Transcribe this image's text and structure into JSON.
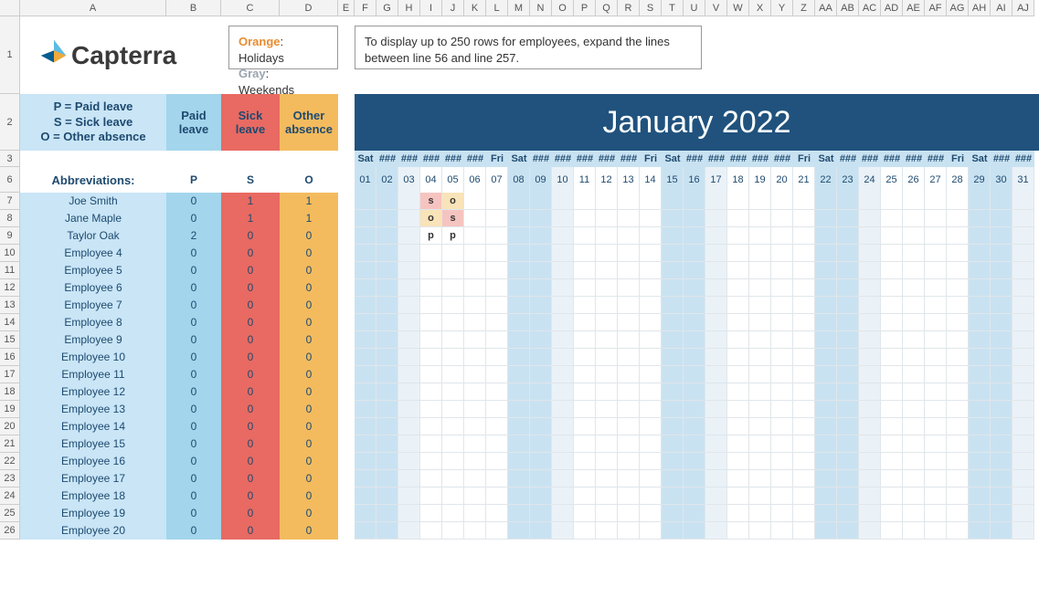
{
  "logo_text": "Capterra",
  "legend": {
    "orange_label": "Orange",
    "orange_text": ": Holidays",
    "gray_label": "Gray",
    "gray_text": ": Weekends"
  },
  "tip_text": "To display up to 250 rows for employees, expand the lines between line 56 and line 257.",
  "key": {
    "p": "P = Paid leave",
    "s": "S = Sick leave",
    "o": "O = Other absence"
  },
  "headers": {
    "paid1": "Paid",
    "paid2": "leave",
    "sick1": "Sick",
    "sick2": "leave",
    "other1": "Other",
    "other2": "absence"
  },
  "month_title": "January 2022",
  "abbrev_label": "Abbreviations:",
  "abbrev": {
    "p": "P",
    "s": "S",
    "o": "O"
  },
  "col_letters": [
    "A",
    "B",
    "C",
    "D",
    "E",
    "F",
    "G",
    "H",
    "I",
    "J",
    "K",
    "L",
    "M",
    "N",
    "O",
    "P",
    "Q",
    "R",
    "S",
    "T",
    "U",
    "V",
    "W",
    "X",
    "Y",
    "Z",
    "AA",
    "AB",
    "AC",
    "AD",
    "AE",
    "AF",
    "AG",
    "AH",
    "AI",
    "AJ"
  ],
  "row_numbers_top": [
    "1",
    "2",
    "3",
    "6"
  ],
  "visible_row_ids": [
    7,
    8,
    9,
    10,
    11,
    12,
    13,
    14,
    15,
    16,
    17,
    18,
    19,
    20,
    21,
    22,
    23,
    24,
    25,
    26
  ],
  "days": [
    {
      "n": "01",
      "wd": "Sat",
      "sat": true
    },
    {
      "n": "02",
      "wd": "###",
      "sun": true
    },
    {
      "n": "03",
      "wd": "###",
      "mon": true
    },
    {
      "n": "04",
      "wd": "###"
    },
    {
      "n": "05",
      "wd": "###"
    },
    {
      "n": "06",
      "wd": "###"
    },
    {
      "n": "07",
      "wd": "Fri"
    },
    {
      "n": "08",
      "wd": "Sat",
      "sat": true
    },
    {
      "n": "09",
      "wd": "###",
      "sun": true
    },
    {
      "n": "10",
      "wd": "###",
      "mon": true
    },
    {
      "n": "11",
      "wd": "###"
    },
    {
      "n": "12",
      "wd": "###"
    },
    {
      "n": "13",
      "wd": "###"
    },
    {
      "n": "14",
      "wd": "Fri"
    },
    {
      "n": "15",
      "wd": "Sat",
      "sat": true
    },
    {
      "n": "16",
      "wd": "###",
      "sun": true
    },
    {
      "n": "17",
      "wd": "###",
      "mon": true
    },
    {
      "n": "18",
      "wd": "###"
    },
    {
      "n": "19",
      "wd": "###"
    },
    {
      "n": "20",
      "wd": "###"
    },
    {
      "n": "21",
      "wd": "Fri"
    },
    {
      "n": "22",
      "wd": "Sat",
      "sat": true
    },
    {
      "n": "23",
      "wd": "###",
      "sun": true
    },
    {
      "n": "24",
      "wd": "###",
      "mon": true
    },
    {
      "n": "25",
      "wd": "###"
    },
    {
      "n": "26",
      "wd": "###"
    },
    {
      "n": "27",
      "wd": "###"
    },
    {
      "n": "28",
      "wd": "Fri"
    },
    {
      "n": "29",
      "wd": "Sat",
      "sat": true
    },
    {
      "n": "30",
      "wd": "###",
      "sun": true
    },
    {
      "n": "31",
      "wd": "###",
      "mon": true
    }
  ],
  "employees": [
    {
      "name": "Joe Smith",
      "p": 0,
      "s": 1,
      "o": 1,
      "marks": {
        "04": "s",
        "05": "o"
      }
    },
    {
      "name": "Jane Maple",
      "p": 0,
      "s": 1,
      "o": 1,
      "marks": {
        "04": "o",
        "05": "s"
      }
    },
    {
      "name": "Taylor Oak",
      "p": 2,
      "s": 0,
      "o": 0,
      "marks": {
        "04": "p",
        "05": "p"
      }
    },
    {
      "name": "Employee 4",
      "p": 0,
      "s": 0,
      "o": 0,
      "marks": {}
    },
    {
      "name": "Employee 5",
      "p": 0,
      "s": 0,
      "o": 0,
      "marks": {}
    },
    {
      "name": "Employee 6",
      "p": 0,
      "s": 0,
      "o": 0,
      "marks": {}
    },
    {
      "name": "Employee 7",
      "p": 0,
      "s": 0,
      "o": 0,
      "marks": {}
    },
    {
      "name": "Employee 8",
      "p": 0,
      "s": 0,
      "o": 0,
      "marks": {}
    },
    {
      "name": "Employee 9",
      "p": 0,
      "s": 0,
      "o": 0,
      "marks": {}
    },
    {
      "name": "Employee 10",
      "p": 0,
      "s": 0,
      "o": 0,
      "marks": {}
    },
    {
      "name": "Employee 11",
      "p": 0,
      "s": 0,
      "o": 0,
      "marks": {}
    },
    {
      "name": "Employee 12",
      "p": 0,
      "s": 0,
      "o": 0,
      "marks": {}
    },
    {
      "name": "Employee 13",
      "p": 0,
      "s": 0,
      "o": 0,
      "marks": {}
    },
    {
      "name": "Employee 14",
      "p": 0,
      "s": 0,
      "o": 0,
      "marks": {}
    },
    {
      "name": "Employee 15",
      "p": 0,
      "s": 0,
      "o": 0,
      "marks": {}
    },
    {
      "name": "Employee 16",
      "p": 0,
      "s": 0,
      "o": 0,
      "marks": {}
    },
    {
      "name": "Employee 17",
      "p": 0,
      "s": 0,
      "o": 0,
      "marks": {}
    },
    {
      "name": "Employee 18",
      "p": 0,
      "s": 0,
      "o": 0,
      "marks": {}
    },
    {
      "name": "Employee 19",
      "p": 0,
      "s": 0,
      "o": 0,
      "marks": {}
    },
    {
      "name": "Employee 20",
      "p": 0,
      "s": 0,
      "o": 0,
      "marks": {}
    }
  ]
}
